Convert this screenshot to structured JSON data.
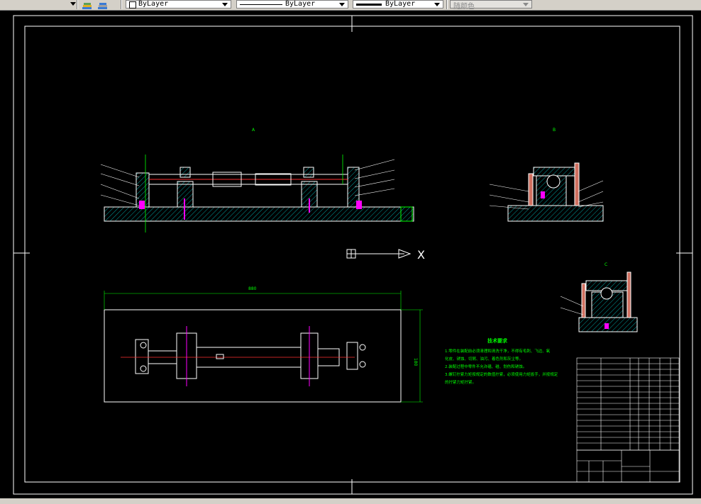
{
  "toolbar": {
    "layer_combo": "ByLayer",
    "linetype_combo": "ByLayer",
    "lineweight_combo": "ByLayer",
    "color_combo": "随颜色"
  },
  "drawing": {
    "tech_title": "技术要求",
    "tech_lines": [
      "1.零件在装配前必须清理和清洗干净，不得有毛刺、飞边、氧",
      "化皮、锈蚀、切屑、油污、着色剂和灰尘等。",
      "2.装配过程中零件不允许磕、碰、划伤和锈蚀。",
      "3.螺钉拧紧力矩按规定的数值拧紧，必须使用力矩扳手，并按规定",
      "的拧紧力矩拧紧。"
    ],
    "dim_length": "880",
    "dim_width": "180",
    "view_labels": [
      "A",
      "B",
      "C"
    ],
    "axis_x": "X"
  },
  "colors": {
    "accent_green": "#00ff00",
    "outline_white": "#ffffff",
    "hatch_cyan": "#00ffff",
    "magenta": "#ff00ff",
    "red": "#ff0000"
  }
}
